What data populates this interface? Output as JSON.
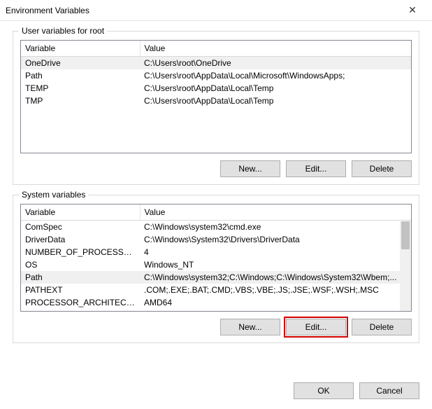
{
  "titlebar": {
    "title": "Environment Variables"
  },
  "groups": {
    "user": {
      "label": "User variables for root",
      "columns": {
        "variable": "Variable",
        "value": "Value"
      },
      "rows": [
        {
          "variable": "OneDrive",
          "value": "C:\\Users\\root\\OneDrive",
          "selected": true
        },
        {
          "variable": "Path",
          "value": "C:\\Users\\root\\AppData\\Local\\Microsoft\\WindowsApps;",
          "selected": false
        },
        {
          "variable": "TEMP",
          "value": "C:\\Users\\root\\AppData\\Local\\Temp",
          "selected": false
        },
        {
          "variable": "TMP",
          "value": "C:\\Users\\root\\AppData\\Local\\Temp",
          "selected": false
        }
      ],
      "buttons": {
        "new": "New...",
        "edit": "Edit...",
        "delete": "Delete"
      }
    },
    "system": {
      "label": "System variables",
      "columns": {
        "variable": "Variable",
        "value": "Value"
      },
      "rows": [
        {
          "variable": "ComSpec",
          "value": "C:\\Windows\\system32\\cmd.exe",
          "selected": false
        },
        {
          "variable": "DriverData",
          "value": "C:\\Windows\\System32\\Drivers\\DriverData",
          "selected": false
        },
        {
          "variable": "NUMBER_OF_PROCESSORS",
          "value": "4",
          "selected": false
        },
        {
          "variable": "OS",
          "value": "Windows_NT",
          "selected": false
        },
        {
          "variable": "Path",
          "value": "C:\\Windows\\system32;C:\\Windows;C:\\Windows\\System32\\Wbem;...",
          "selected": true
        },
        {
          "variable": "PATHEXT",
          "value": ".COM;.EXE;.BAT;.CMD;.VBS;.VBE;.JS;.JSE;.WSF;.WSH;.MSC",
          "selected": false
        },
        {
          "variable": "PROCESSOR_ARCHITECTURE",
          "value": "AMD64",
          "selected": false
        }
      ],
      "buttons": {
        "new": "New...",
        "edit": "Edit...",
        "delete": "Delete"
      }
    }
  },
  "footer": {
    "ok": "OK",
    "cancel": "Cancel"
  }
}
